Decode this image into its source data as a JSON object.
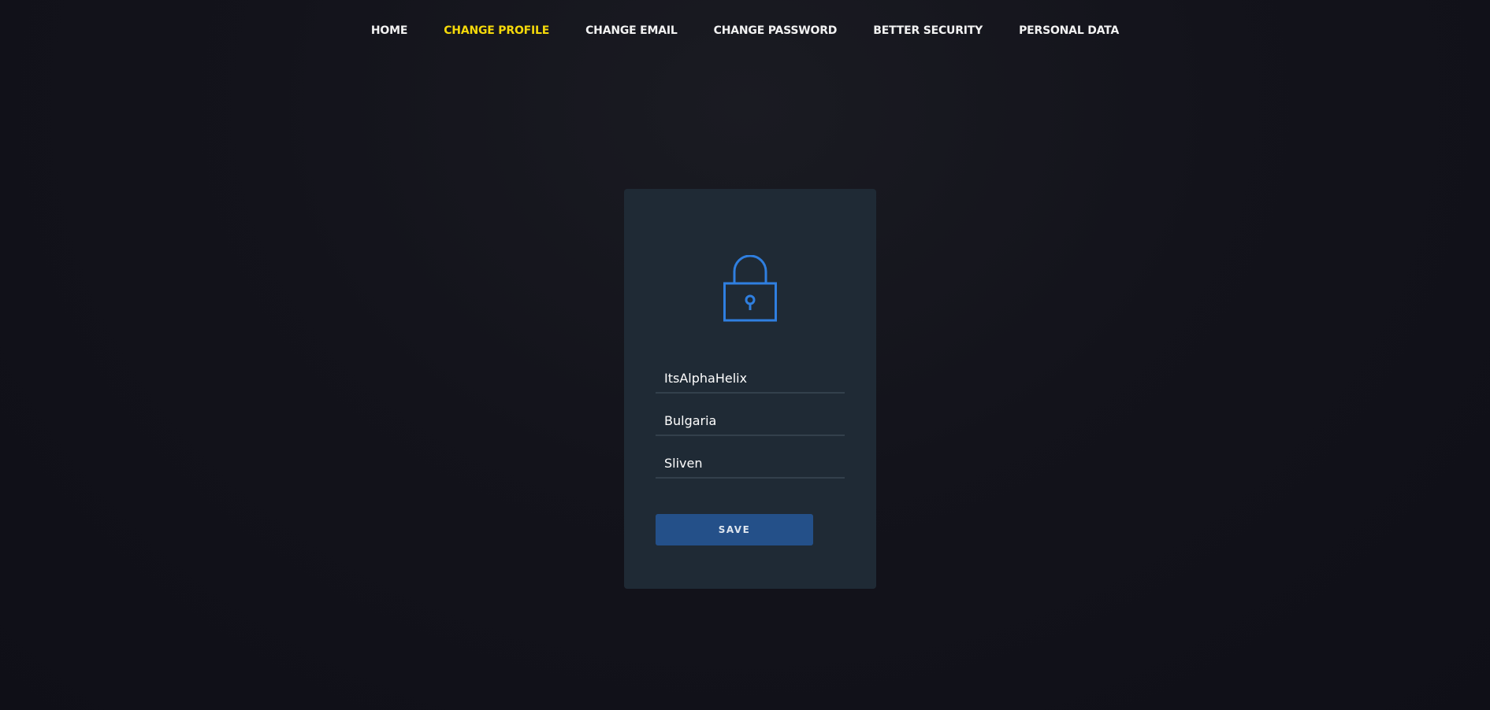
{
  "nav": {
    "items": [
      {
        "label": "HOME"
      },
      {
        "label": "CHANGE PROFILE"
      },
      {
        "label": "CHANGE EMAIL"
      },
      {
        "label": "CHANGE PASSWORD"
      },
      {
        "label": "BETTER SECURITY"
      },
      {
        "label": "PERSONAL DATA"
      }
    ],
    "active_color": "#f5d90a"
  },
  "form": {
    "icon": "lock-icon",
    "icon_color": "#2f7fe0",
    "username": "ItsAlphaHelix",
    "country": "Bulgaria",
    "city": "Sliven",
    "save_label": "SAVE",
    "button_color": "#245089"
  }
}
